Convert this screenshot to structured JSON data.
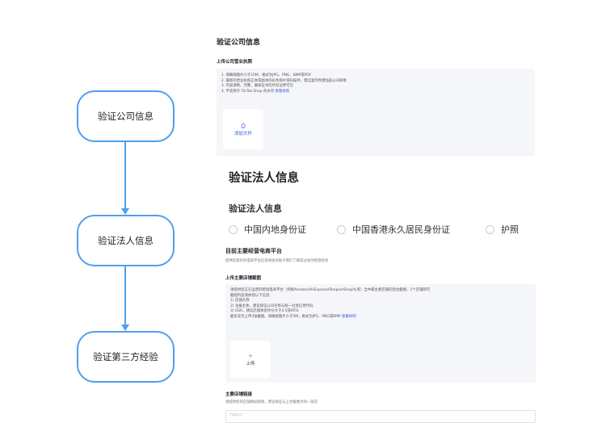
{
  "flow": {
    "steps": [
      {
        "label": "验证公司信息"
      },
      {
        "label": "验证法人信息"
      },
      {
        "label": "验证第三方经验"
      }
    ]
  },
  "company": {
    "title": "验证公司信息",
    "license_label": "上传公司营业执照",
    "tips": [
      "1. 请确保图片小于10M，格式为JPG、PNG、BMP或PDF",
      "2. 最新的营业执照正本或副本的彩色照片或扫描件，需自复印件需加盖公司邮章",
      "3. 内容清晰、完整，确保证书的所有边界可见",
      "4. 不适用于 TikTok Shop 的水印"
    ],
    "tip_link": "查看样例",
    "upload_label": "添加文件"
  },
  "legal": {
    "title": "验证法人信息",
    "subtitle": "验证法人信息",
    "options": [
      {
        "label": "中国内地身份证"
      },
      {
        "label": "中国香港永久居民身份证"
      },
      {
        "label": "护照"
      }
    ]
  },
  "platform": {
    "title": "目前主要经营电商平台",
    "desc": "提供您现有的电商平台信息将会有助于我们了解您过往的经营经验",
    "store_label": "上传主要店铺截图",
    "tips": [
      "请提供您正在运营的跨境电商平台（例如Amazon/AliExpress/Shopee/Shopify等）当中最主要店铺的后台截图，1个店铺即可",
      "截图内容请体现以下信息：",
      "1) 店铺名称",
      "2) 注册主体，建议保证公司名称与统一社会信用代码",
      "3) GSR，建议店铺体验评分大于4.5或95%",
      "最多支持上传3张截图。请确保图片小于5M，格式为JPG、PNG或BMP"
    ],
    "tip_link": "查看样例",
    "upload_icon": "+",
    "upload_label": "上传",
    "link_label": "主要店铺链接",
    "link_desc": "请提供您的店铺网站链接，建议保证与上述截图为同一家店",
    "link_placeholder": "https://"
  }
}
